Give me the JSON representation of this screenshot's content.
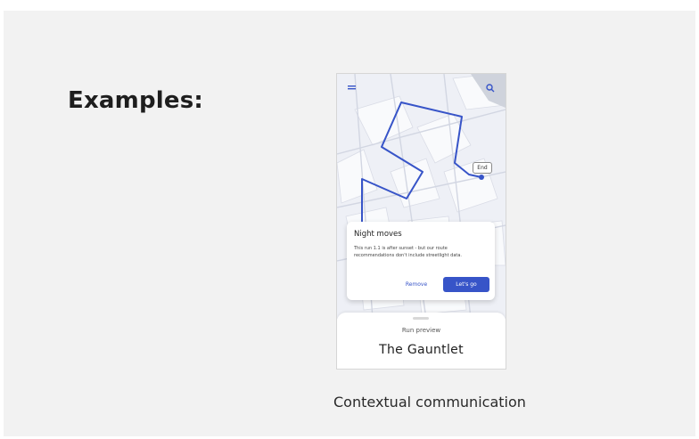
{
  "slide": {
    "heading": "Examples:",
    "caption": "Contextual communication"
  },
  "phone": {
    "map": {
      "end_label": "End",
      "route_color": "#3754c8"
    },
    "dialog": {
      "title": "Night moves",
      "body": "This run 1.1 is after sunset - but our route recommendations don't include streetlight data.",
      "remove_label": "Remove",
      "letsgo_label": "Let's go"
    },
    "sheet": {
      "subtitle": "Run preview",
      "route_name": "The Gauntlet"
    }
  },
  "colors": {
    "accent": "#3754c8",
    "slide_bg": "#f2f2f2"
  },
  "icons": {
    "menu": "menu-icon",
    "search": "search-icon"
  }
}
